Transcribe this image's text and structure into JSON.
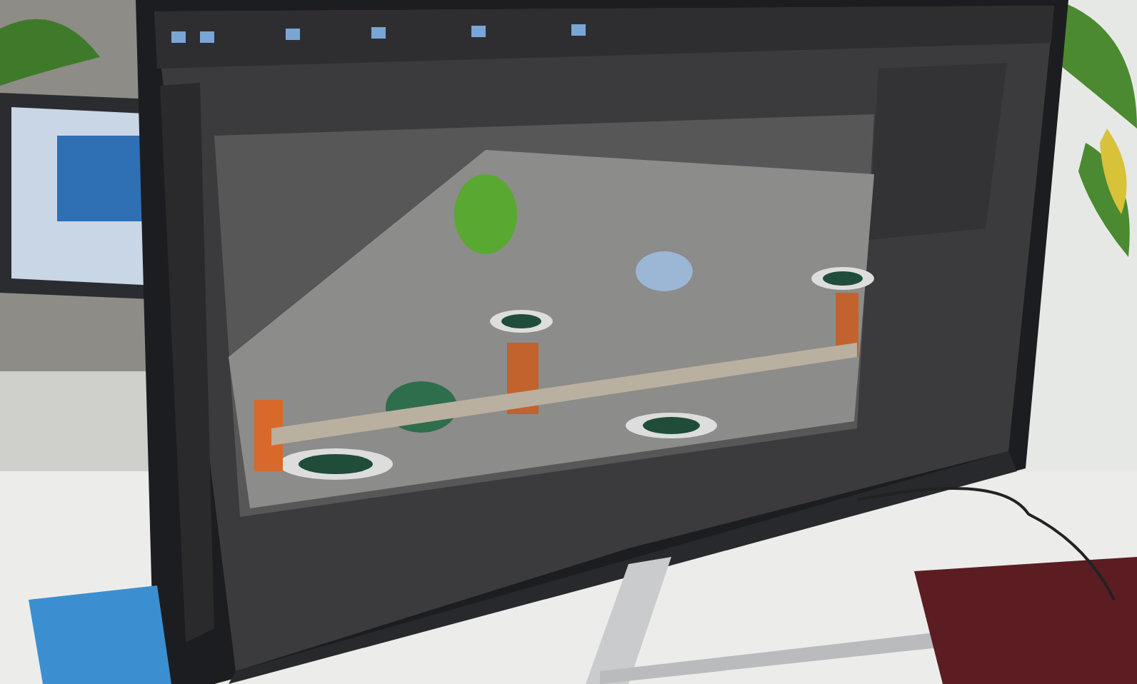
{
  "photo": {
    "kind": "desk-monitor"
  }
}
